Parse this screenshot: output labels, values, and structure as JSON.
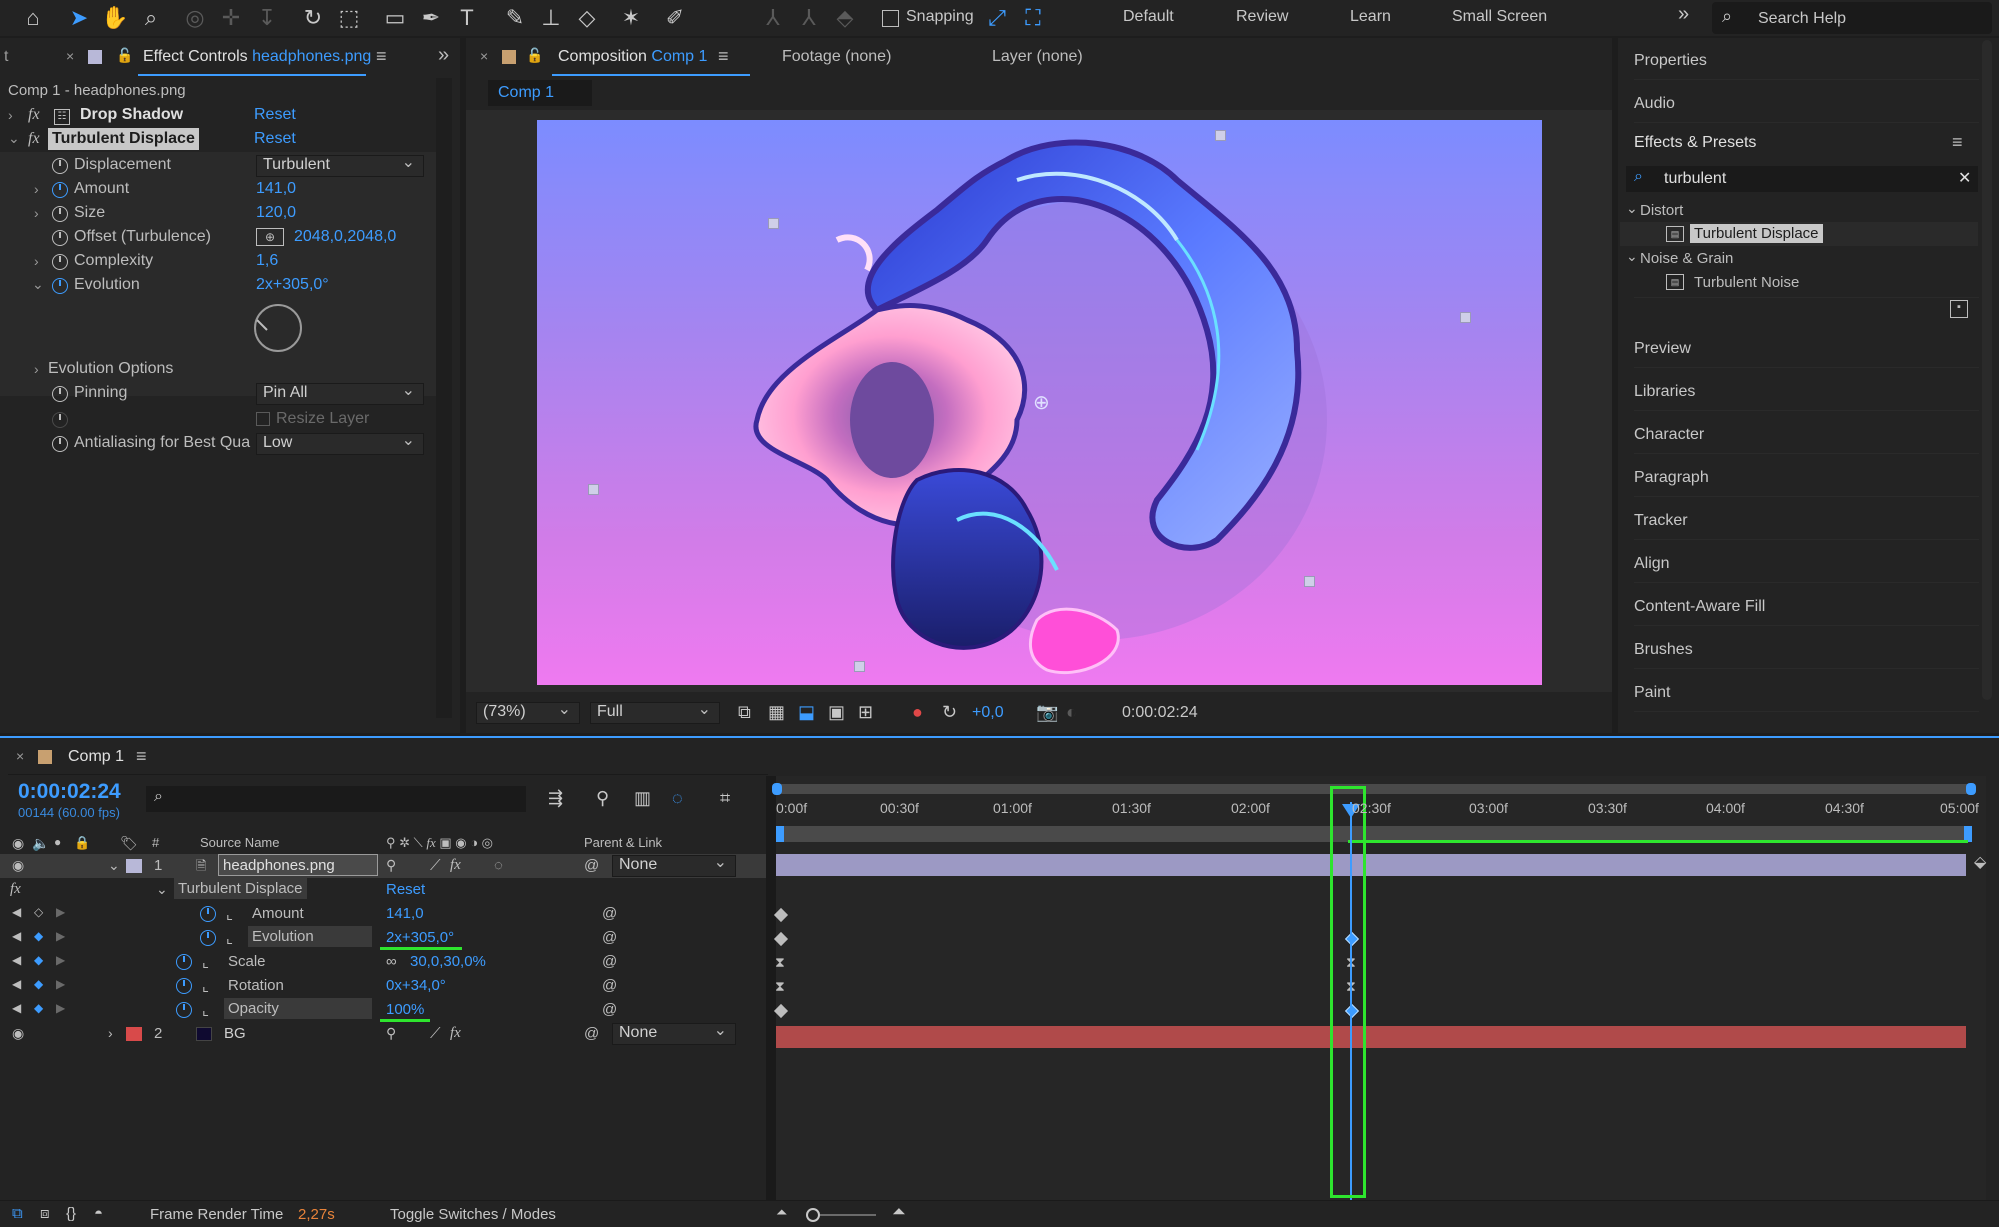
{
  "toolbar": {
    "snapping_label": "Snapping",
    "workspaces": [
      "Default",
      "Review",
      "Learn",
      "Small Screen"
    ],
    "more": "»",
    "search_placeholder": "Search Help"
  },
  "effect_controls": {
    "left_tab": "t",
    "tab_label": "Effect Controls",
    "tab_file": "headphones.png",
    "breadcrumb": "Comp 1 - headphones.png",
    "drop_shadow": {
      "name": "Drop Shadow",
      "reset": "Reset"
    },
    "turbulent": {
      "name": "Turbulent Displace",
      "reset": "Reset"
    },
    "props": {
      "displacement": {
        "label": "Displacement",
        "value": "Turbulent"
      },
      "amount": {
        "label": "Amount",
        "value": "141,0"
      },
      "size": {
        "label": "Size",
        "value": "120,0"
      },
      "offset": {
        "label": "Offset (Turbulence)",
        "value": "2048,0,2048,0"
      },
      "complexity": {
        "label": "Complexity",
        "value": "1,6"
      },
      "evolution": {
        "label": "Evolution",
        "value": "2x+305,0°"
      },
      "evolution_options": {
        "label": "Evolution Options"
      },
      "pinning": {
        "label": "Pinning",
        "value": "Pin All"
      },
      "resize_layer": {
        "label": "Resize Layer"
      },
      "antialiasing": {
        "label": "Antialiasing for Best Qua",
        "value": "Low"
      }
    }
  },
  "composition": {
    "tab_label": "Composition",
    "tab_comp": "Comp 1",
    "footage_tab": "Footage (none)",
    "layer_tab": "Layer (none)",
    "subtab": "Comp 1",
    "zoom": "(73%)",
    "resolution": "Full",
    "exposure": "+0,0",
    "timecode": "0:00:02:24"
  },
  "right_panel": {
    "properties": "Properties",
    "audio": "Audio",
    "effects_presets": "Effects & Presets",
    "search_value": "turbulent",
    "categories": [
      {
        "name": "Distort",
        "item": "Turbulent Displace"
      },
      {
        "name": "Noise & Grain",
        "item": "Turbulent Noise"
      }
    ],
    "panels": [
      "Preview",
      "Libraries",
      "Character",
      "Paragraph",
      "Tracker",
      "Align",
      "Content-Aware Fill",
      "Brushes",
      "Paint"
    ]
  },
  "timeline": {
    "tab": "Comp 1",
    "timecode": "0:00:02:24",
    "frame_info": "00144 (60.00 fps)",
    "col_hash": "#",
    "col_source": "Source Name",
    "col_parent": "Parent & Link",
    "ruler": [
      "0:00f",
      "00:30f",
      "01:00f",
      "01:30f",
      "02:00f",
      "02:30f",
      "03:00f",
      "03:30f",
      "04:00f",
      "04:30f",
      "05:00f"
    ],
    "playhead_time": "02:30f",
    "layer1": {
      "num": "1",
      "name": "headphones.png",
      "parent": "None"
    },
    "layer2": {
      "num": "2",
      "name": "BG",
      "parent": "None"
    },
    "effect_name": "Turbulent Displace",
    "effect_reset": "Reset",
    "props": {
      "amount": {
        "label": "Amount",
        "value": "141,0"
      },
      "evolution": {
        "label": "Evolution",
        "value": "2x+305,0°"
      },
      "scale": {
        "label": "Scale",
        "value": "30,0,30,0%"
      },
      "rotation": {
        "label": "Rotation",
        "value": "0x+34,0°"
      },
      "opacity": {
        "label": "Opacity",
        "value": "100%"
      }
    },
    "fx_label": "fx",
    "frame_render_label": "Frame Render Time",
    "frame_render_value": "2,27s",
    "toggle_label": "Toggle Switches / Modes"
  },
  "colors": {
    "accent": "#3d9cff",
    "highlight_green": "#2ee52e",
    "layer1_bar": "#9c99c4",
    "layer2_bar": "#b04a4a",
    "render_time": "#e8833a"
  }
}
